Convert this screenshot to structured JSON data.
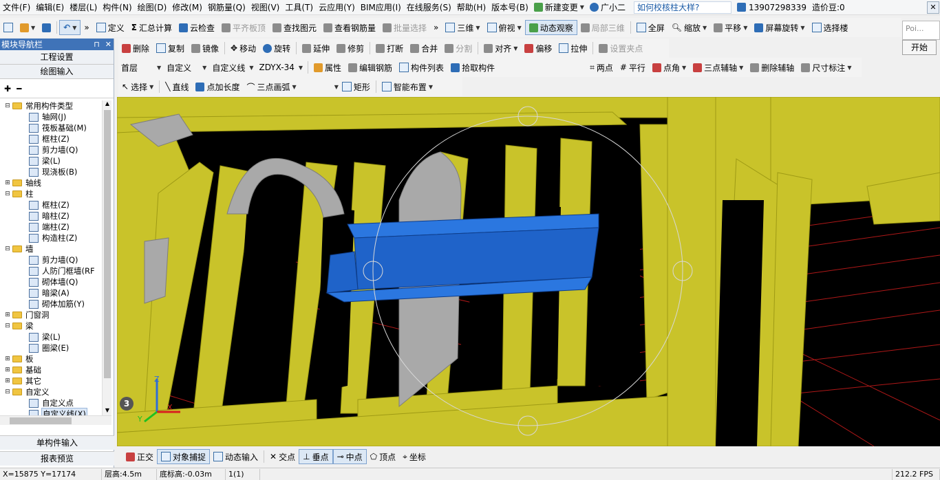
{
  "menubar": {
    "items": [
      "文件(F)",
      "编辑(E)",
      "楼层(L)",
      "构件(N)",
      "绘图(D)",
      "修改(M)",
      "钢筋量(Q)",
      "视图(V)",
      "工具(T)",
      "云应用(Y)",
      "BIM应用(I)",
      "在线服务(S)",
      "帮助(H)",
      "版本号(B)"
    ],
    "new_change": "新建变更",
    "assistant": "广小二",
    "question": "如何校核柱大样?",
    "phone": "13907298339",
    "coins": "造价豆:0"
  },
  "toolbar1": {
    "define": "定义",
    "calc": "汇总计算",
    "cloud_check": "云检查",
    "flush_slab": "平齐板顶",
    "find_elem": "查找图元",
    "view_rebar": "查看钢筋量",
    "batch_select": "批量选择",
    "view3d": "三维",
    "top_view": "俯视",
    "dynamic_observe": "动态观察",
    "local_3d": "局部三维",
    "fullscreen": "全屏",
    "zoom": "缩放",
    "pan": "平移",
    "screen_rotate": "屏幕旋转",
    "select_floor": "选择楼"
  },
  "toolbar2": {
    "delete": "删除",
    "copy": "复制",
    "mirror": "镜像",
    "move": "移动",
    "rotate": "旋转",
    "extend": "延伸",
    "trim": "修剪",
    "break": "打断",
    "merge": "合并",
    "split": "分割",
    "align": "对齐",
    "offset": "偏移",
    "stretch": "拉伸",
    "set_clamp": "设置夹点"
  },
  "toolbar3": {
    "floor": "首层",
    "type": "自定义",
    "subtype": "自定义线",
    "name": "ZDYX-34",
    "attr": "属性",
    "edit_rebar": "编辑钢筋",
    "elem_list": "构件列表",
    "pick_elem": "拾取构件",
    "two_points": "两点",
    "parallel": "平行",
    "point_angle": "点角",
    "three_point_aux": "三点辅轴",
    "delete_aux": "删除辅轴",
    "dimension": "尺寸标注"
  },
  "toolbar4": {
    "select": "选择",
    "line": "直线",
    "point_length": "点加长度",
    "arc3": "三点画弧",
    "rect": "矩形",
    "smart_layout": "智能布置"
  },
  "leftpanel": {
    "title": "模块导航栏",
    "project_settings": "工程设置",
    "drawing_input": "绘图输入",
    "tree": [
      {
        "level": 0,
        "toggle": "⊟",
        "folder": true,
        "label": "常用构件类型"
      },
      {
        "level": 1,
        "label": "轴网(J)"
      },
      {
        "level": 1,
        "label": "筏板基础(M)"
      },
      {
        "level": 1,
        "label": "框柱(Z)"
      },
      {
        "level": 1,
        "label": "剪力墙(Q)"
      },
      {
        "level": 1,
        "label": "梁(L)"
      },
      {
        "level": 1,
        "label": "现浇板(B)"
      },
      {
        "level": 0,
        "toggle": "⊞",
        "folder": true,
        "label": "轴线"
      },
      {
        "level": 0,
        "toggle": "⊟",
        "folder": true,
        "label": "柱"
      },
      {
        "level": 1,
        "label": "框柱(Z)"
      },
      {
        "level": 1,
        "label": "暗柱(Z)"
      },
      {
        "level": 1,
        "label": "端柱(Z)"
      },
      {
        "level": 1,
        "label": "构造柱(Z)"
      },
      {
        "level": 0,
        "toggle": "⊟",
        "folder": true,
        "label": "墙"
      },
      {
        "level": 1,
        "label": "剪力墙(Q)"
      },
      {
        "level": 1,
        "label": "人防门框墙(RF"
      },
      {
        "level": 1,
        "label": "砌体墙(Q)"
      },
      {
        "level": 1,
        "label": "暗梁(A)"
      },
      {
        "level": 1,
        "label": "砌体加筋(Y)"
      },
      {
        "level": 0,
        "toggle": "⊞",
        "folder": true,
        "label": "门窗洞"
      },
      {
        "level": 0,
        "toggle": "⊟",
        "folder": true,
        "label": "梁"
      },
      {
        "level": 1,
        "label": "梁(L)"
      },
      {
        "level": 1,
        "label": "圈梁(E)"
      },
      {
        "level": 0,
        "toggle": "⊞",
        "folder": true,
        "label": "板"
      },
      {
        "level": 0,
        "toggle": "⊞",
        "folder": true,
        "label": "基础"
      },
      {
        "level": 0,
        "toggle": "⊞",
        "folder": true,
        "label": "其它"
      },
      {
        "level": 0,
        "toggle": "⊟",
        "folder": true,
        "label": "自定义"
      },
      {
        "level": 1,
        "label": "自定义点"
      },
      {
        "level": 1,
        "label": "自定义线(X)",
        "selected": true
      }
    ],
    "single_input": "单构件输入",
    "report_preview": "报表预览"
  },
  "snapbar": {
    "ortho": "正交",
    "object_snap": "对象捕捉",
    "dynamic_input": "动态输入",
    "intersection": "交点",
    "perpendicular": "垂点",
    "midpoint": "中点",
    "vertex": "顶点",
    "coordinate": "坐标"
  },
  "statusbar": {
    "coords": "X=15875 Y=17174",
    "floor_height": "层高:4.5m",
    "base_height": "底标高:-0.03m",
    "count": "1(1)",
    "fps": "212.2 FPS"
  },
  "popup": {
    "poi": "Poi...",
    "start": "开始"
  },
  "viewport": {
    "axis_number": "3"
  },
  "colors": {
    "model_yellow": "#c9c32a",
    "beam_blue": "#1f63c9",
    "grid_red": "#b01818",
    "nav_title": "#3f73b8"
  }
}
